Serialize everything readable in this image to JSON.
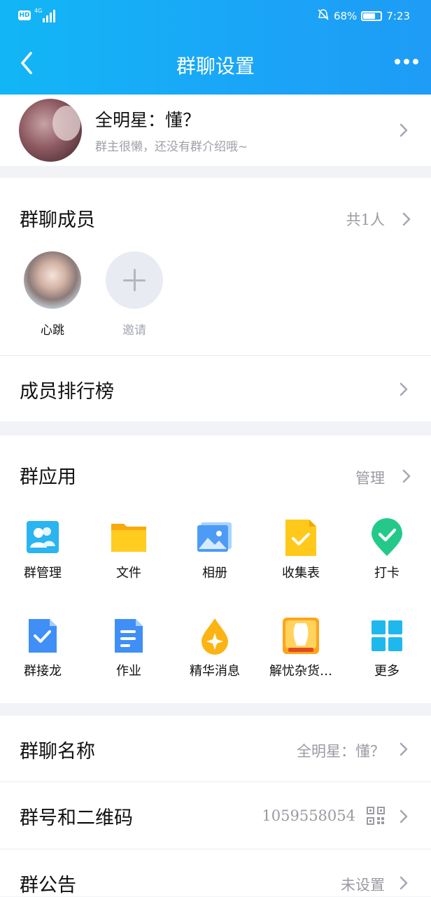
{
  "status_bar": {
    "hd": "HD",
    "network": "4G",
    "battery_percent": "68%",
    "time": "7:23",
    "battery_level": 0.68
  },
  "header": {
    "title": "群聊设置"
  },
  "group": {
    "name": "全明星：懂？",
    "intro": "群主很懒，还没有群介绍哦~"
  },
  "members": {
    "title": "群聊成员",
    "count": "共1人",
    "list": [
      {
        "name": "心跳"
      },
      {
        "name": "邀请"
      }
    ]
  },
  "ranking": {
    "title": "成员排行榜"
  },
  "apps": {
    "title": "群应用",
    "manage": "管理",
    "items": [
      {
        "label": "群管理",
        "icon": "group-manage-icon"
      },
      {
        "label": "文件",
        "icon": "folder-icon"
      },
      {
        "label": "相册",
        "icon": "album-icon"
      },
      {
        "label": "收集表",
        "icon": "collection-form-icon"
      },
      {
        "label": "打卡",
        "icon": "check-in-icon"
      },
      {
        "label": "群接龙",
        "icon": "group-chain-icon"
      },
      {
        "label": "作业",
        "icon": "homework-icon"
      },
      {
        "label": "精华消息",
        "icon": "essence-message-icon"
      },
      {
        "label": "解忧杂货…",
        "icon": "grocery-store-icon"
      },
      {
        "label": "更多",
        "icon": "more-apps-icon"
      }
    ]
  },
  "settings": {
    "name_label": "群聊名称",
    "name_value": "全明星：懂？",
    "number_label": "群号和二维码",
    "number_value": "1059558054",
    "notice_label": "群公告",
    "notice_value": "未设置"
  },
  "colors": {
    "header_start": "#12b6f5",
    "header_end": "#1e9cf6",
    "background": "#f2f3f7",
    "secondary_text": "#9a9aa2"
  }
}
